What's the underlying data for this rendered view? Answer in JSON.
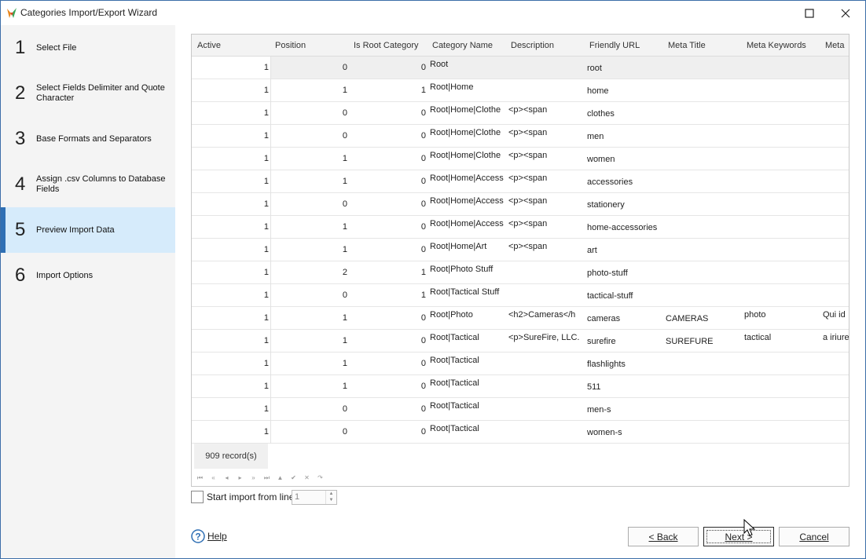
{
  "window": {
    "title": "Categories Import/Export Wizard"
  },
  "sidebar": {
    "steps": [
      {
        "num": "1",
        "label": "Select File"
      },
      {
        "num": "2",
        "label": "Select Fields Delimiter and Quote Character"
      },
      {
        "num": "3",
        "label": "Base Formats and Separators"
      },
      {
        "num": "4",
        "label": "Assign .csv Columns to Database Fields"
      },
      {
        "num": "5",
        "label": "Preview Import Data"
      },
      {
        "num": "6",
        "label": "Import Options"
      }
    ],
    "active_step": 5
  },
  "grid": {
    "columns": [
      "Active",
      "Position",
      "Is Root Category",
      "Category Name",
      "Description",
      "Friendly URL",
      "Meta Title",
      "Meta Keywords",
      "Meta"
    ],
    "rows": [
      [
        "1",
        "0",
        "0",
        "Root",
        "",
        "root",
        "",
        "",
        ""
      ],
      [
        "1",
        "1",
        "1",
        "Root|Home",
        "",
        "home",
        "",
        "",
        ""
      ],
      [
        "1",
        "0",
        "0",
        "Root|Home|Clothe",
        "<p><span",
        "clothes",
        "",
        "",
        ""
      ],
      [
        "1",
        "0",
        "0",
        "Root|Home|Clothe",
        "<p><span",
        "men",
        "",
        "",
        ""
      ],
      [
        "1",
        "1",
        "0",
        "Root|Home|Clothe",
        "<p><span",
        "women",
        "",
        "",
        ""
      ],
      [
        "1",
        "1",
        "0",
        "Root|Home|Access",
        "<p><span",
        "accessories",
        "",
        "",
        ""
      ],
      [
        "1",
        "0",
        "0",
        "Root|Home|Access",
        "<p><span",
        "stationery",
        "",
        "",
        ""
      ],
      [
        "1",
        "1",
        "0",
        "Root|Home|Access",
        "<p><span",
        "home-accessories",
        "",
        "",
        ""
      ],
      [
        "1",
        "1",
        "0",
        "Root|Home|Art",
        "<p><span",
        "art",
        "",
        "",
        ""
      ],
      [
        "1",
        "2",
        "1",
        "Root|Photo Stuff",
        "",
        "photo-stuff",
        "",
        "",
        ""
      ],
      [
        "1",
        "0",
        "1",
        "Root|Tactical Stuff",
        "",
        "tactical-stuff",
        "",
        "",
        ""
      ],
      [
        "1",
        "1",
        "0",
        "Root|Photo",
        "<h2>Cameras</h",
        "cameras",
        "CAMERAS",
        "photo",
        "Qui id"
      ],
      [
        "1",
        "1",
        "0",
        "Root|Tactical",
        "<p>SureFire, LLC.",
        "surefire",
        "SUREFURE",
        "tactical",
        "a iriure"
      ],
      [
        "1",
        "1",
        "0",
        "Root|Tactical",
        "",
        "flashlights",
        "",
        "",
        ""
      ],
      [
        "1",
        "1",
        "0",
        "Root|Tactical",
        "",
        "511",
        "",
        "",
        ""
      ],
      [
        "1",
        "0",
        "0",
        "Root|Tactical",
        "",
        "men-s",
        "",
        "",
        ""
      ],
      [
        "1",
        "0",
        "0",
        "Root|Tactical",
        "",
        "women-s",
        "",
        "",
        ""
      ]
    ],
    "record_count": "909 record(s)",
    "nav_buttons": [
      "first-icon",
      "prev-page-icon",
      "prev-icon",
      "next-icon",
      "next-page-icon",
      "last-icon",
      "insert-icon",
      "post-icon",
      "cancel-icon",
      "refresh-icon"
    ]
  },
  "start_import": {
    "label": "Start import from line",
    "value": "1",
    "checked": false
  },
  "footer": {
    "help_label": "Help",
    "back_label": "< Back",
    "next_label": "Next >",
    "cancel_label": "Cancel"
  },
  "colors": {
    "accent": "#2f6fb4",
    "active_step_bg": "#d6ebfb",
    "sidebar_bg": "#f4f4f4"
  }
}
